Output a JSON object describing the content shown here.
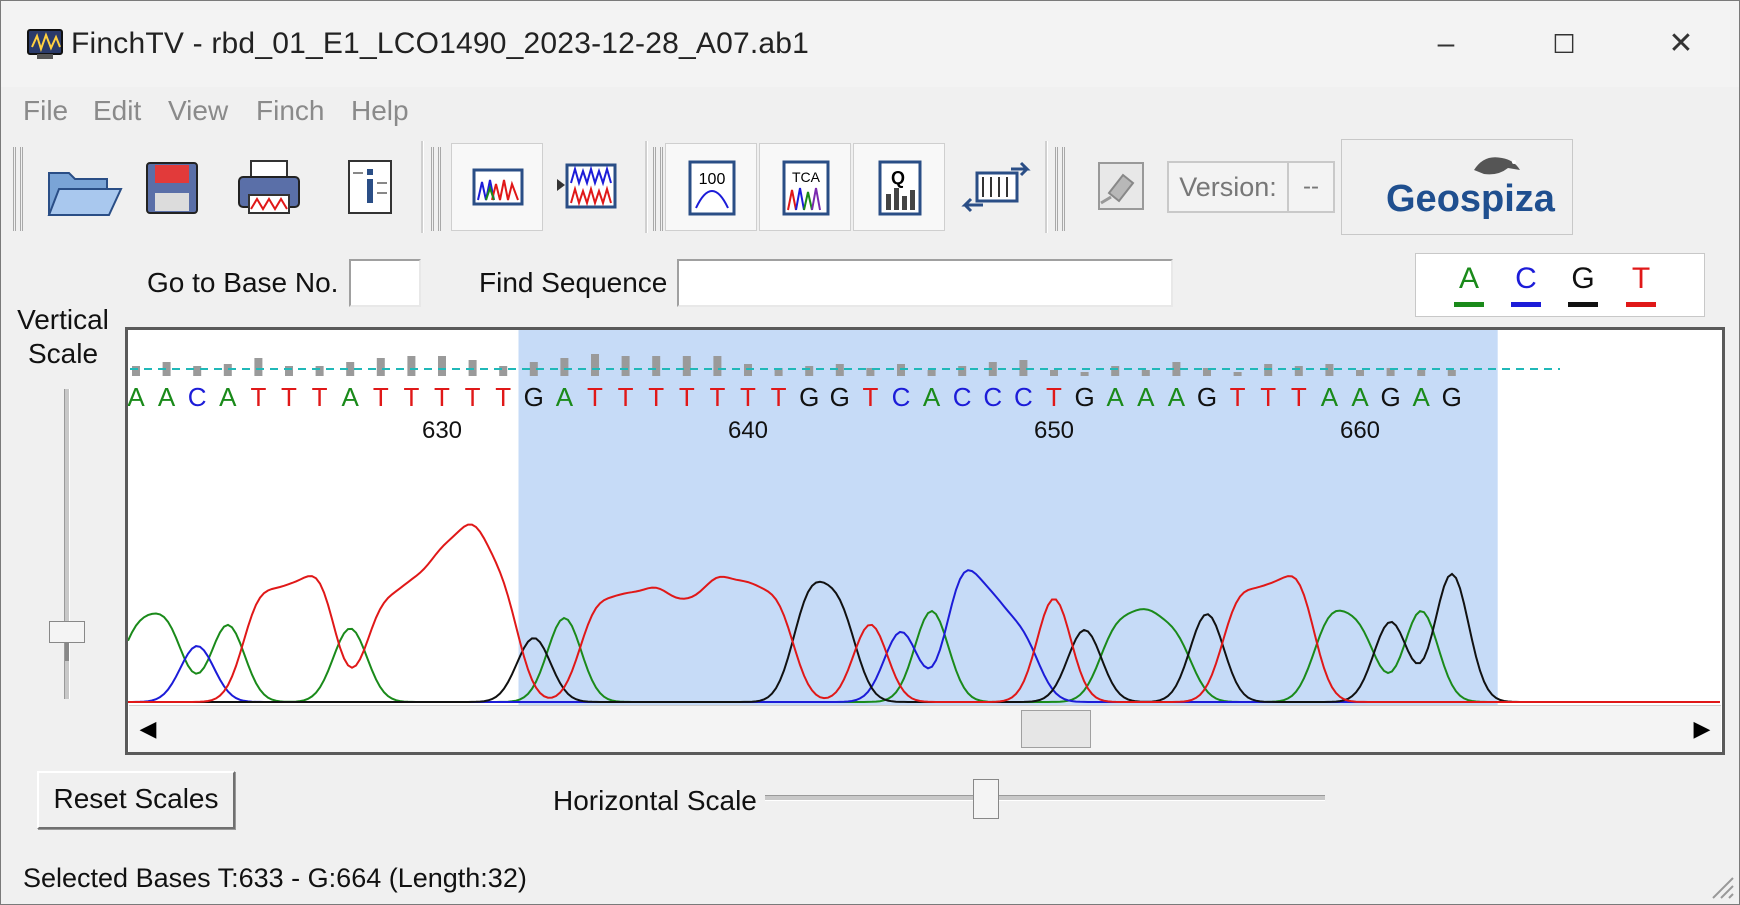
{
  "window": {
    "title": "FinchTV - rbd_01_E1_LCO1490_2023-12-28_A07.ab1",
    "minimize": "–",
    "maximize": "☐",
    "close": "✕"
  },
  "menu": [
    "File",
    "Edit",
    "View",
    "Finch",
    "Help"
  ],
  "toolbar": {
    "icons": [
      "open-folder-icon",
      "save-disk-icon",
      "print-icon",
      "info-icon",
      "single-trace-icon",
      "multi-trace-icon",
      "quality-100-icon",
      "tca-trace-icon",
      "quality-bars-icon",
      "reverse-complement-icon",
      "bookmark-icon"
    ],
    "icon_labels": {
      "quality": "100",
      "tca": "TCA",
      "q": "Q"
    },
    "version_label": "Version:",
    "version_value": "--",
    "brand": "Geospiza"
  },
  "goto": {
    "label": "Go to Base No.",
    "value": ""
  },
  "find": {
    "label": "Find Sequence",
    "value": ""
  },
  "legend": [
    {
      "base": "A",
      "color": "#1a8a1a"
    },
    {
      "base": "C",
      "color": "#1c1cd8"
    },
    {
      "base": "G",
      "color": "#111111"
    },
    {
      "base": "T",
      "color": "#e01818"
    }
  ],
  "vertical_scale": {
    "line1": "Vertical",
    "line2": "Scale",
    "level": 0.25
  },
  "horizontal_scale": {
    "label": "Horizontal Scale",
    "level": 0.39
  },
  "reset_button": "Reset Scales",
  "trace": {
    "first_base_number": 620,
    "bases": "AACATTTATTTTTGATTTTTTTGGTCACCCTGAAAGTTTAAGAG",
    "tick_labels": [
      "630",
      "640",
      "650",
      "660"
    ],
    "selection": {
      "start": 633,
      "end": 664
    }
  },
  "scrollbar": {
    "left_arrow": "◀",
    "right_arrow": "▶",
    "position": 0.55
  },
  "status": "Selected Bases T:633 - G:664  (Length:32)"
}
